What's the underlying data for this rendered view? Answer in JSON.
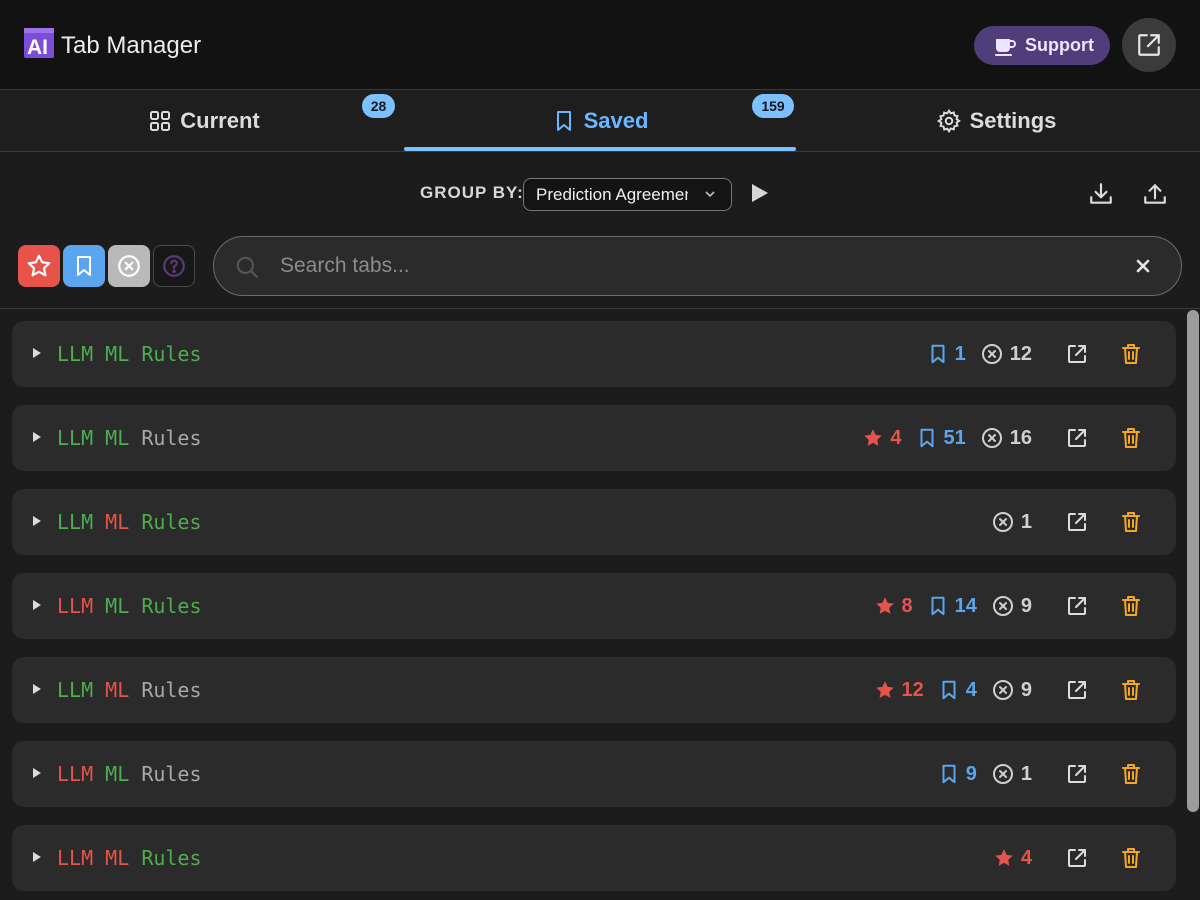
{
  "app": {
    "title": "Tab Manager",
    "support_label": "Support"
  },
  "tabs": [
    {
      "label": "Current",
      "count": "28"
    },
    {
      "label": "Saved",
      "count": "159"
    },
    {
      "label": "Settings"
    }
  ],
  "active_tab": "Saved",
  "toolbar": {
    "group_by_label": "GROUP BY:",
    "group_by_value": "Prediction Agreement"
  },
  "search": {
    "placeholder": "Search tabs..."
  },
  "colors": {
    "accent": "#7cc0ff",
    "star": "#e5534b",
    "bookmark": "#5ba4ee",
    "delete": "#f5a623",
    "green": "#4cae4f",
    "red": "#e5534b",
    "gray": "#a8a8a8"
  },
  "groups": [
    {
      "words": [
        {
          "text": "LLM",
          "color": "green"
        },
        {
          "text": "ML",
          "color": "green"
        },
        {
          "text": "Rules",
          "color": "green"
        }
      ],
      "stars": null,
      "bookmarks": "1",
      "crosses": "12"
    },
    {
      "words": [
        {
          "text": "LLM",
          "color": "green"
        },
        {
          "text": "ML",
          "color": "green"
        },
        {
          "text": "Rules",
          "color": "gray"
        }
      ],
      "stars": "4",
      "bookmarks": "51",
      "crosses": "16"
    },
    {
      "words": [
        {
          "text": "LLM",
          "color": "green"
        },
        {
          "text": "ML",
          "color": "red"
        },
        {
          "text": "Rules",
          "color": "green"
        }
      ],
      "stars": null,
      "bookmarks": null,
      "crosses": "1"
    },
    {
      "words": [
        {
          "text": "LLM",
          "color": "red"
        },
        {
          "text": "ML",
          "color": "green"
        },
        {
          "text": "Rules",
          "color": "green"
        }
      ],
      "stars": "8",
      "bookmarks": "14",
      "crosses": "9"
    },
    {
      "words": [
        {
          "text": "LLM",
          "color": "green"
        },
        {
          "text": "ML",
          "color": "red"
        },
        {
          "text": "Rules",
          "color": "gray"
        }
      ],
      "stars": "12",
      "bookmarks": "4",
      "crosses": "9"
    },
    {
      "words": [
        {
          "text": "LLM",
          "color": "red"
        },
        {
          "text": "ML",
          "color": "green"
        },
        {
          "text": "Rules",
          "color": "gray"
        }
      ],
      "stars": null,
      "bookmarks": "9",
      "crosses": "1"
    },
    {
      "words": [
        {
          "text": "LLM",
          "color": "red"
        },
        {
          "text": "ML",
          "color": "red"
        },
        {
          "text": "Rules",
          "color": "green"
        }
      ],
      "stars": "4",
      "bookmarks": null,
      "crosses": null
    }
  ],
  "icons": {
    "logo": "ai-logo-icon",
    "support": "coffee-cup-icon",
    "external": "open-external-icon",
    "current_tab": "grid-icon",
    "saved_tab": "bookmark-icon",
    "settings_tab": "gear-icon",
    "download": "download-icon",
    "upload": "upload-icon",
    "search": "search-icon",
    "clear": "close-icon"
  }
}
